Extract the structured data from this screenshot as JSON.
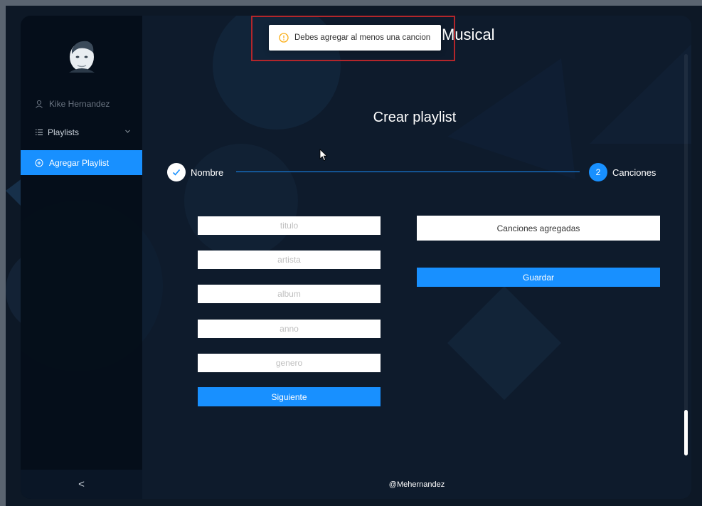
{
  "app": {
    "header_title": "Musical",
    "page_title": "Crear playlist",
    "footer": "@Mehernandez"
  },
  "sidebar": {
    "user_name": "Kike Hernandez",
    "playlists_label": "Playlists",
    "add_playlist_label": "Agregar Playlist",
    "collapse_glyph": "<"
  },
  "steps": [
    {
      "label": "Nombre",
      "status": "finished"
    },
    {
      "label": "Canciones",
      "number": "2",
      "status": "current"
    }
  ],
  "form": {
    "title_placeholder": "titulo",
    "artist_placeholder": "artista",
    "album_placeholder": "album",
    "year_placeholder": "anno",
    "genre_placeholder": "genero",
    "next_button": "Siguiente"
  },
  "songs_panel": {
    "header": "Canciones agregadas",
    "save_button": "Guardar"
  },
  "toast": {
    "message": "Debes agregar al menos una cancion",
    "icon": "warning-circle-icon"
  },
  "colors": {
    "accent": "#1890ff",
    "background": "#0e1b2c",
    "warning": "#faad14",
    "highlight_outline": "#b3262b"
  }
}
